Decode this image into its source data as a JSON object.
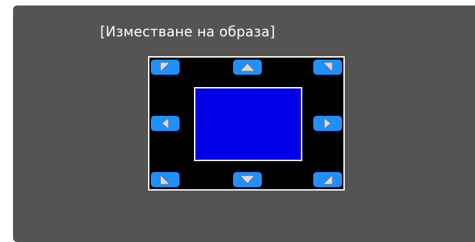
{
  "dialog": {
    "title": "[Изместване на образа]"
  },
  "controls": {
    "buttons": [
      {
        "name": "move-up-left-button",
        "icon": "arrow-up-left-icon"
      },
      {
        "name": "move-up-button",
        "icon": "arrow-up-icon"
      },
      {
        "name": "move-up-right-button",
        "icon": "arrow-up-right-icon"
      },
      {
        "name": "move-left-button",
        "icon": "arrow-left-icon"
      },
      {
        "name": "move-right-button",
        "icon": "arrow-right-icon"
      },
      {
        "name": "move-down-left-button",
        "icon": "arrow-down-left-icon"
      },
      {
        "name": "move-down-button",
        "icon": "arrow-down-icon"
      },
      {
        "name": "move-down-right-button",
        "icon": "arrow-down-right-icon"
      }
    ]
  },
  "colors": {
    "background": "#545454",
    "frame": "#000000",
    "image_area": "#0000e6",
    "button": "#1e90ff",
    "arrow": "#d9d9d9"
  }
}
